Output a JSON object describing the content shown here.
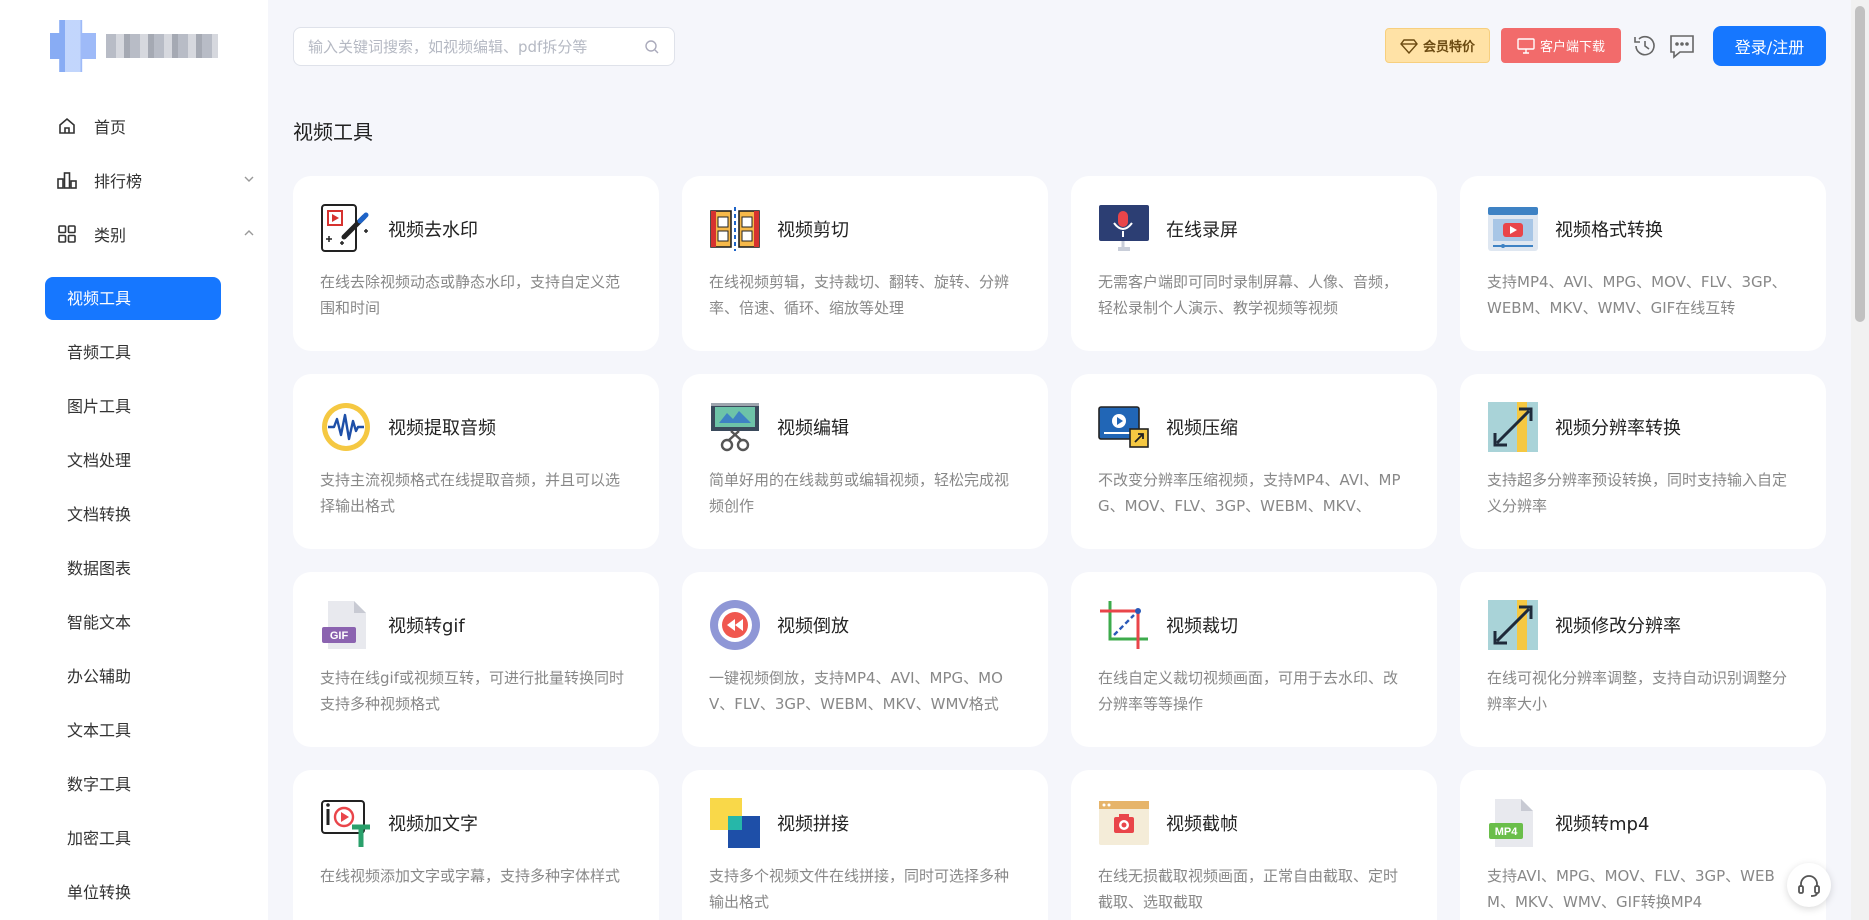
{
  "header": {
    "search_placeholder": "输入关键词搜索，如视频编辑、pdf拆分等",
    "vip_label": "会员特价",
    "client_label": "客户端下载",
    "login_label": "登录/注册"
  },
  "sidebar": {
    "main": [
      {
        "label": "首页",
        "icon": "home-icon"
      },
      {
        "label": "排行榜",
        "icon": "bar-chart-icon"
      },
      {
        "label": "类别",
        "icon": "grid-icon"
      }
    ],
    "sub": [
      {
        "label": "视频工具",
        "active": true
      },
      {
        "label": "音频工具"
      },
      {
        "label": "图片工具"
      },
      {
        "label": "文档处理"
      },
      {
        "label": "文档转换"
      },
      {
        "label": "数据图表"
      },
      {
        "label": "智能文本"
      },
      {
        "label": "办公辅助"
      },
      {
        "label": "文本工具"
      },
      {
        "label": "数字工具"
      },
      {
        "label": "加密工具"
      },
      {
        "label": "单位转换"
      }
    ]
  },
  "main": {
    "section_title": "视频工具",
    "tools": [
      {
        "name": "视频去水印",
        "desc": "在线去除视频动态或静态水印，支持自定义范围和时间",
        "icon": "watermark-remove-icon"
      },
      {
        "name": "视频剪切",
        "desc": "在线视频剪辑，支持裁切、翻转、旋转、分辨率、倍速、循环、缩放等处理",
        "icon": "film-cut-icon"
      },
      {
        "name": "在线录屏",
        "desc": "无需客户端即可同时录制屏幕、人像、音频，轻松录制个人演示、教学视频等视频",
        "icon": "screen-record-icon"
      },
      {
        "name": "视频格式转换",
        "desc": "支持MP4、AVI、MPG、MOV、FLV、3GP、WEBM、MKV、WMV、GIF在线互转",
        "icon": "video-convert-icon"
      },
      {
        "name": "视频提取音频",
        "desc": "支持主流视频格式在线提取音频，并且可以选择输出格式",
        "icon": "audio-wave-icon"
      },
      {
        "name": "视频编辑",
        "desc": "简单好用的在线裁剪或编辑视频，轻松完成视频创作",
        "icon": "video-edit-icon"
      },
      {
        "name": "视频压缩",
        "desc": "不改变分辨率压缩视频，支持MP4、AVI、MPG、MOV、FLV、3GP、WEBM、MKV、",
        "icon": "video-compress-icon"
      },
      {
        "name": "视频分辨率转换",
        "desc": "支持超多分辨率预设转换，同时支持输入自定义分辨率",
        "icon": "resolution-icon"
      },
      {
        "name": "视频转gif",
        "desc": "支持在线gif或视频互转，可进行批量转换同时支持多种视频格式",
        "icon": "gif-file-icon"
      },
      {
        "name": "视频倒放",
        "desc": "一键视频倒放，支持MP4、AVI、MPG、MOV、FLV、3GP、WEBM、MKV、WMV格式",
        "icon": "rewind-icon"
      },
      {
        "name": "视频裁切",
        "desc": "在线自定义裁切视频画面，可用于去水印、改分辨率等等操作",
        "icon": "crop-icon"
      },
      {
        "name": "视频修改分辨率",
        "desc": "在线可视化分辨率调整，支持自动识别调整分辨率大小",
        "icon": "resolution-icon"
      },
      {
        "name": "视频加文字",
        "desc": "在线视频添加文字或字幕，支持多种字体样式",
        "icon": "video-text-icon"
      },
      {
        "name": "视频拼接",
        "desc": "支持多个视频文件在线拼接，同时可选择多种输出格式",
        "icon": "video-merge-icon"
      },
      {
        "name": "视频截帧",
        "desc": "在线无损截取视频画面，正常自由截取、定时截取、选取截取",
        "icon": "frame-capture-icon"
      },
      {
        "name": "视频转mp4",
        "desc": "支持AVI、MPG、MOV、FLV、3GP、WEBM、MKV、WMV、GIF转换MP4",
        "icon": "mp4-file-icon"
      }
    ]
  },
  "colors": {
    "accent": "#1677ff",
    "vip_bg": "#ffe2a6",
    "client_bg": "#f26b6b"
  }
}
